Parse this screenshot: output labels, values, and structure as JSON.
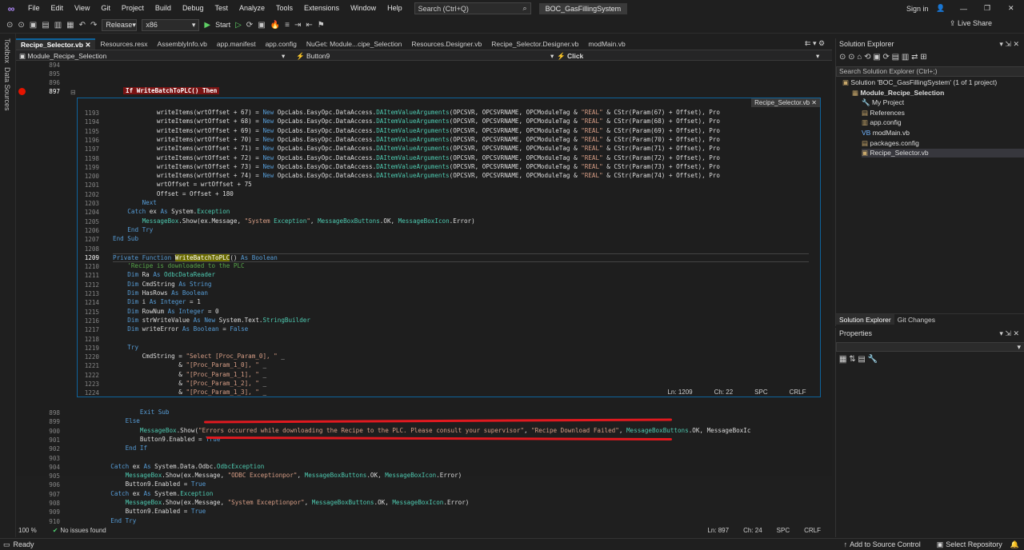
{
  "menu": {
    "items": [
      "File",
      "Edit",
      "View",
      "Git",
      "Project",
      "Build",
      "Debug",
      "Test",
      "Analyze",
      "Tools",
      "Extensions",
      "Window",
      "Help"
    ],
    "search_placeholder": "Search (Ctrl+Q)",
    "solution_name": "BOC_GasFillingSystem",
    "sign_in": "Sign in"
  },
  "toolbar": {
    "config": "Release",
    "platform": "x86",
    "start": "Start",
    "live_share": "Live Share"
  },
  "side": {
    "toolbox": "Toolbox",
    "data_sources": "Data Sources"
  },
  "tabs": [
    "Recipe_Selector.vb",
    "Resources.resx",
    "AssemblyInfo.vb",
    "app.manifest",
    "app.config",
    "NuGet: Module...cipe_Selection",
    "Resources.Designer.vb",
    "Recipe_Selector.Designer.vb",
    "modMain.vb"
  ],
  "navbar": {
    "scope": "Module_Recipe_Selection",
    "object": "Button9",
    "event": "Click"
  },
  "top_code": {
    "lines": [
      {
        "n": "894",
        "code": ""
      },
      {
        "n": "895",
        "code": ""
      },
      {
        "n": "896",
        "code": ""
      },
      {
        "n": "897",
        "code": "If WriteBatchToPLC() Then"
      }
    ]
  },
  "peek": {
    "file": "Recipe_Selector.vb",
    "lines": [
      {
        "n": "1193",
        "code": "            writeItems(wrtOffset + 67) = New OpcLabs.EasyOpc.DataAccess.DAItemValueArguments(OPCSVR, OPCSVRNAME, OPCModuleTag & \"REAL\" & CStr(Param(67) + Offset), Pro"
      },
      {
        "n": "1194",
        "code": "            writeItems(wrtOffset + 68) = New OpcLabs.EasyOpc.DataAccess.DAItemValueArguments(OPCSVR, OPCSVRNAME, OPCModuleTag & \"REAL\" & CStr(Param(68) + Offset), Pro"
      },
      {
        "n": "1195",
        "code": "            writeItems(wrtOffset + 69) = New OpcLabs.EasyOpc.DataAccess.DAItemValueArguments(OPCSVR, OPCSVRNAME, OPCModuleTag & \"REAL\" & CStr(Param(69) + Offset), Pro"
      },
      {
        "n": "1196",
        "code": "            writeItems(wrtOffset + 70) = New OpcLabs.EasyOpc.DataAccess.DAItemValueArguments(OPCSVR, OPCSVRNAME, OPCModuleTag & \"REAL\" & CStr(Param(70) + Offset), Pro"
      },
      {
        "n": "1197",
        "code": "            writeItems(wrtOffset + 71) = New OpcLabs.EasyOpc.DataAccess.DAItemValueArguments(OPCSVR, OPCSVRNAME, OPCModuleTag & \"REAL\" & CStr(Param(71) + Offset), Pro"
      },
      {
        "n": "1198",
        "code": "            writeItems(wrtOffset + 72) = New OpcLabs.EasyOpc.DataAccess.DAItemValueArguments(OPCSVR, OPCSVRNAME, OPCModuleTag & \"REAL\" & CStr(Param(72) + Offset), Pro"
      },
      {
        "n": "1199",
        "code": "            writeItems(wrtOffset + 73) = New OpcLabs.EasyOpc.DataAccess.DAItemValueArguments(OPCSVR, OPCSVRNAME, OPCModuleTag & \"REAL\" & CStr(Param(73) + Offset), Pro"
      },
      {
        "n": "1200",
        "code": "            writeItems(wrtOffset + 74) = New OpcLabs.EasyOpc.DataAccess.DAItemValueArguments(OPCSVR, OPCSVRNAME, OPCModuleTag & \"REAL\" & CStr(Param(74) + Offset), Pro"
      },
      {
        "n": "1201",
        "code": "            wrtOffset = wrtOffset + 75"
      },
      {
        "n": "1202",
        "code": "            Offset = Offset + 180"
      },
      {
        "n": "1203",
        "code": "        Next"
      },
      {
        "n": "1204",
        "code": "    Catch ex As System.Exception"
      },
      {
        "n": "1205",
        "code": "        MessageBox.Show(ex.Message, \"System Exception\", MessageBoxButtons.OK, MessageBoxIcon.Error)"
      },
      {
        "n": "1206",
        "code": "    End Try"
      },
      {
        "n": "1207",
        "code": "End Sub"
      },
      {
        "n": "1208",
        "code": ""
      },
      {
        "n": "1209",
        "code": "Private Function WriteBatchToPLC() As Boolean"
      },
      {
        "n": "1210",
        "code": "    'Recipe is downloaded to the PLC"
      },
      {
        "n": "1211",
        "code": "    Dim Ra As OdbcDataReader"
      },
      {
        "n": "1212",
        "code": "    Dim CmdString As String"
      },
      {
        "n": "1213",
        "code": "    Dim HasRows As Boolean"
      },
      {
        "n": "1214",
        "code": "    Dim i As Integer = 1"
      },
      {
        "n": "1215",
        "code": "    Dim RowNum As Integer = 0"
      },
      {
        "n": "1216",
        "code": "    Dim strWriteValue As New System.Text.StringBuilder"
      },
      {
        "n": "1217",
        "code": "    Dim writeError As Boolean = False"
      },
      {
        "n": "1218",
        "code": ""
      },
      {
        "n": "1219",
        "code": "    Try"
      },
      {
        "n": "1220",
        "code": "        CmdString = \"Select [Proc_Param_0], \" _"
      },
      {
        "n": "1221",
        "code": "                  & \"[Proc_Param_1_0], \" _"
      },
      {
        "n": "1222",
        "code": "                  & \"[Proc_Param_1_1], \" _"
      },
      {
        "n": "1223",
        "code": "                  & \"[Proc_Param_1_2], \" _"
      },
      {
        "n": "1224",
        "code": "                  & \"[Proc_Param_1_3], \" _"
      }
    ],
    "status": {
      "ln": "Ln: 1209",
      "ch": "Ch: 22",
      "spc": "SPC",
      "crlf": "CRLF"
    }
  },
  "bottom_code": {
    "lines": [
      {
        "n": "898",
        "code": "            Exit Sub"
      },
      {
        "n": "899",
        "code": "        Else"
      },
      {
        "n": "900",
        "code": "            MessageBox.Show(\"Errors occurred while downloading the Recipe to the PLC. Please consult your supervisor\", \"Recipe Download Failed\", MessageBoxButtons.OK, MessageBoxIc"
      },
      {
        "n": "901",
        "code": "            Button9.Enabled = True"
      },
      {
        "n": "902",
        "code": "        End If"
      },
      {
        "n": "903",
        "code": ""
      },
      {
        "n": "904",
        "code": "    Catch ex As System.Data.Odbc.OdbcException"
      },
      {
        "n": "905",
        "code": "        MessageBox.Show(ex.Message, \"ODBC Exceptionpor\", MessageBoxButtons.OK, MessageBoxIcon.Error)"
      },
      {
        "n": "906",
        "code": "        Button9.Enabled = True"
      },
      {
        "n": "907",
        "code": "    Catch ex As System.Exception"
      },
      {
        "n": "908",
        "code": "        MessageBox.Show(ex.Message, \"System Exceptionpor\", MessageBoxButtons.OK, MessageBoxIcon.Error)"
      },
      {
        "n": "909",
        "code": "        Button9.Enabled = True"
      },
      {
        "n": "910",
        "code": "    End Try"
      }
    ]
  },
  "editor_status": {
    "zoom": "100 %",
    "issues": "No issues found",
    "ln": "Ln: 897",
    "ch": "Ch: 24",
    "spc": "SPC",
    "crlf": "CRLF"
  },
  "solution_explorer": {
    "title": "Solution Explorer",
    "search_placeholder": "Search Solution Explorer (Ctrl+;)",
    "items": [
      {
        "label": "Solution 'BOC_GasFillingSystem' (1 of 1 project)",
        "indent": 0
      },
      {
        "label": "Module_Recipe_Selection",
        "indent": 1
      },
      {
        "label": "My Project",
        "indent": 2
      },
      {
        "label": "References",
        "indent": 2
      },
      {
        "label": "app.config",
        "indent": 2
      },
      {
        "label": "modMain.vb",
        "indent": 2
      },
      {
        "label": "packages.config",
        "indent": 2
      },
      {
        "label": "Recipe_Selector.vb",
        "indent": 2
      }
    ],
    "tabs": [
      "Solution Explorer",
      "Git Changes"
    ]
  },
  "properties": {
    "title": "Properties"
  },
  "statusbar": {
    "ready": "Ready",
    "source_control": "Add to Source Control",
    "select_repo": "Select Repository"
  }
}
